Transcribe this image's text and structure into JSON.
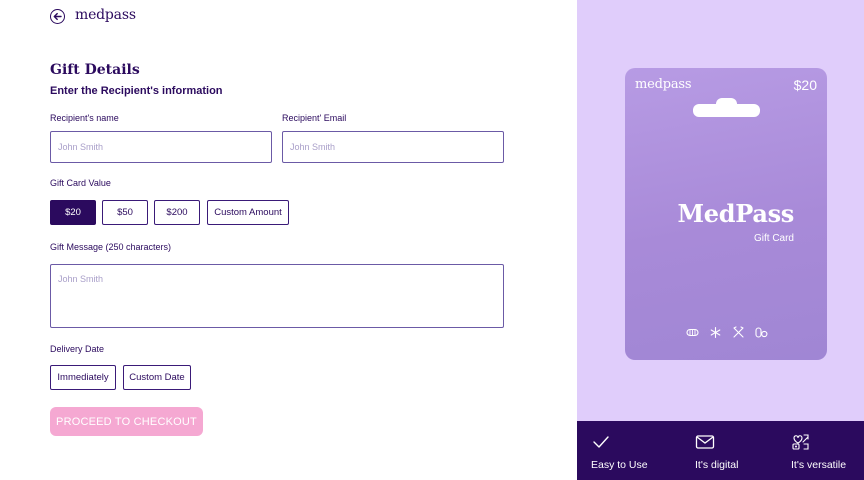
{
  "header": {
    "logo_text": "medpass",
    "back_icon": "arrow-left-circle-icon"
  },
  "form": {
    "title": "Gift Details",
    "subtitle": "Enter the Recipient's information",
    "recipient_name": {
      "label": "Recipient's name",
      "placeholder": "John Smith",
      "value": ""
    },
    "recipient_email": {
      "label": "Recipient' Email",
      "placeholder": "John Smith",
      "value": ""
    },
    "gift_value": {
      "label": "Gift Card Value",
      "options": [
        "$20",
        "$50",
        "$200",
        "Custom Amount"
      ],
      "selected": "$20"
    },
    "message": {
      "label": "Gift Message (250 characters)",
      "placeholder": "John Smith",
      "value": ""
    },
    "delivery": {
      "label": "Delivery Date",
      "options": [
        "Immediately",
        "Custom Date"
      ]
    },
    "proceed_label": "PROCEED TO CHECKOUT"
  },
  "card": {
    "logo_text": "medpass",
    "price": "$20",
    "brand": "MedPass",
    "subtitle": "Gift Card",
    "icons": [
      "pill-icon",
      "sparkle-icon",
      "cutlery-icon",
      "pills-icon"
    ]
  },
  "features": [
    {
      "label": "Easy to Use",
      "icon": "check-icon"
    },
    {
      "label": "It's digital",
      "icon": "mail-icon"
    },
    {
      "label": "It's versatile",
      "icon": "versatile-icon"
    }
  ],
  "colors": {
    "primary": "#2b0a5e",
    "panel_bg": "#e0cdfb",
    "card_bg": "#a88ad8",
    "proceed_bg": "#f5a8d2",
    "bottom_bar": "#2b0a5e"
  }
}
